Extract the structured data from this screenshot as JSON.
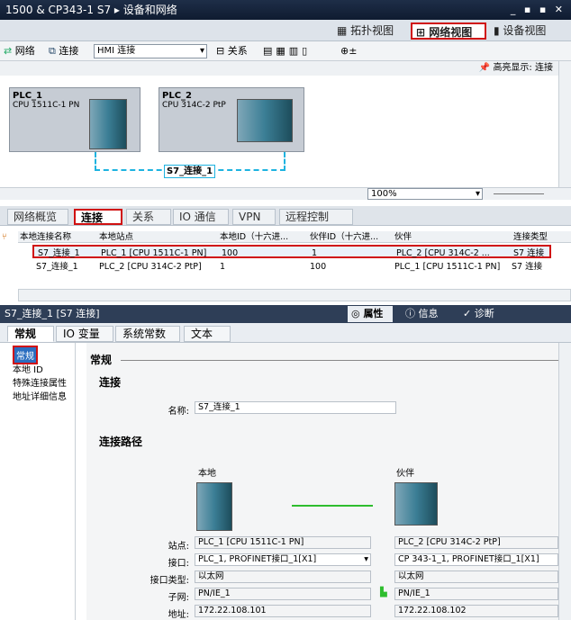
{
  "window": {
    "title": "1500 & CP343-1 S7 ▸ 设备和网络",
    "controls": "_ ▪ ▪ ✕"
  },
  "views": {
    "topology": "拓扑视图",
    "network": "网络视图",
    "device": "设备视图"
  },
  "toolbar": {
    "network": "网络",
    "connect": "连接",
    "connection_type": "HMI 连接",
    "relations": "关系",
    "zoom_icon": "zoom-icon"
  },
  "canvas": {
    "highlight": "高亮显示: 连接",
    "plc1": {
      "name": "PLC_1",
      "cpu": "CPU 1511C-1 PN"
    },
    "plc2": {
      "name": "PLC_2",
      "cpu": "CPU 314C-2 PtP"
    },
    "connection_label": "S7_连接_1",
    "zoom": "100%"
  },
  "tabs": [
    "网络概览",
    "连接",
    "关系",
    "IO 通信",
    "VPN",
    "远程控制"
  ],
  "grid": {
    "headers": [
      "本地连接名称",
      "本地站点",
      "本地ID（十六进...",
      "伙伴ID（十六进...",
      "伙伴",
      "连接类型"
    ],
    "rows": [
      {
        "name": "S7_连接_1",
        "station": "PLC_1 [CPU 1511C-1 PN]",
        "local_id": "100",
        "partner_id": "1",
        "partner": "PLC_2 [CPU 314C-2 ...",
        "type": "S7 连接"
      },
      {
        "name": "S7_连接_1",
        "station": "PLC_2 [CPU 314C-2 PtP]",
        "local_id": "1",
        "partner_id": "100",
        "partner": "PLC_1 [CPU 1511C-1 PN]",
        "type": "S7 连接"
      }
    ]
  },
  "props": {
    "title": "S7_连接_1 [S7 连接]",
    "tabs": [
      "属性",
      "信息",
      "诊断"
    ],
    "subtabs": [
      "常规",
      "IO 变量",
      "系统常数",
      "文本"
    ],
    "nav": [
      "常规",
      "本地 ID",
      "特殊连接属性",
      "地址详细信息"
    ],
    "section": "常规",
    "conn_title": "连接",
    "name_label": "名称:",
    "name_value": "S7_连接_1",
    "path_title": "连接路径",
    "local": "本地",
    "partner": "伙伴",
    "fields": {
      "station_label": "站点:",
      "local_station": "PLC_1 [CPU 1511C-1 PN]",
      "partner_station": "PLC_2 [CPU 314C-2 PtP]",
      "iface_label": "接口:",
      "local_iface": "PLC_1, PROFINET接口_1[X1]",
      "partner_iface": "CP 343-1_1, PROFINET接口_1[X1]",
      "iftype_label": "接口类型:",
      "local_iftype": "以太网",
      "partner_iftype": "以太网",
      "subnet_label": "子网:",
      "local_subnet": "PN/IE_1",
      "partner_subnet": "PN/IE_1",
      "addr_label": "地址:",
      "local_addr": "172.22.108.101",
      "partner_addr": "172.22.108.102"
    }
  }
}
